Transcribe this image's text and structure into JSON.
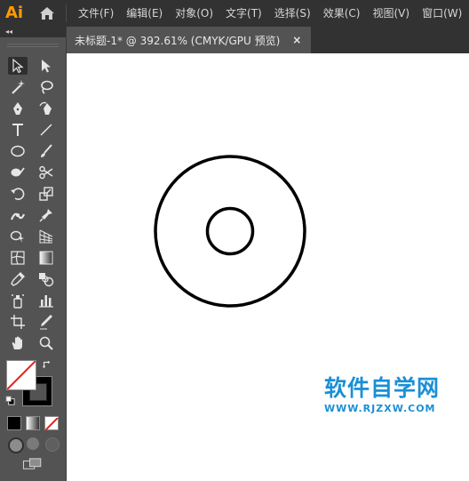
{
  "app": {
    "logo": "Ai"
  },
  "menu": {
    "items": [
      {
        "label": "文件(F)"
      },
      {
        "label": "编辑(E)"
      },
      {
        "label": "对象(O)"
      },
      {
        "label": "文字(T)"
      },
      {
        "label": "选择(S)"
      },
      {
        "label": "效果(C)"
      },
      {
        "label": "视图(V)"
      },
      {
        "label": "窗口(W)"
      }
    ]
  },
  "toolbar": {
    "collapse": "◂◂",
    "tools": [
      "selection-tool-icon",
      "direct-selection-tool-icon",
      "magic-wand-tool-icon",
      "lasso-tool-icon",
      "pen-tool-icon",
      "curvature-tool-icon",
      "type-tool-icon",
      "line-segment-tool-icon",
      "ellipse-tool-icon",
      "paintbrush-tool-icon",
      "shaper-tool-icon",
      "scissors-tool-icon",
      "rotate-tool-icon",
      "scale-tool-icon",
      "width-tool-icon",
      "puppet-warp-tool-icon",
      "shape-builder-tool-icon",
      "perspective-grid-tool-icon",
      "mesh-tool-icon",
      "gradient-tool-icon",
      "eyedropper-tool-icon",
      "blend-tool-icon",
      "symbol-sprayer-tool-icon",
      "column-graph-tool-icon",
      "artboard-tool-icon",
      "slice-tool-icon",
      "hand-tool-icon",
      "zoom-tool-icon"
    ],
    "fill_color": "#ffffff",
    "stroke_color": "#000000",
    "none_color": "#e02020"
  },
  "document": {
    "tab_title": "未标题-1* @ 392.61% (CMYK/GPU 预览)",
    "close": "×"
  },
  "watermark": {
    "chinese": "软件自学网",
    "url": "WWW.RJZXW.COM"
  },
  "colors": {
    "menu_bg": "#323232",
    "panel_bg": "#535353",
    "canvas_bg": "#ffffff",
    "accent_logo": "#ff9a00",
    "watermark": "#1a8fd6"
  }
}
